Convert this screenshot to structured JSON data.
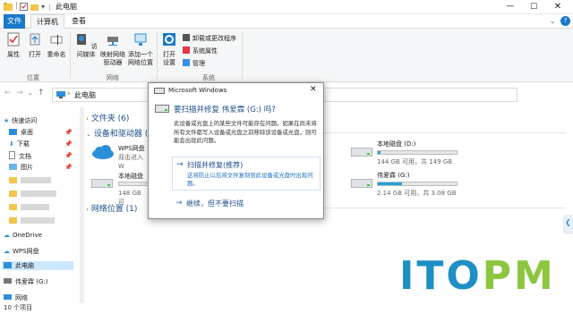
{
  "window": {
    "title": "此电脑"
  },
  "tabs": {
    "file": "文件",
    "computer": "计算机",
    "view": "查看"
  },
  "ribbon": {
    "properties": "属性",
    "open": "打开",
    "rename": "重命名",
    "group_location": "位置",
    "access_media": "访问媒体",
    "map_drive": "映射网络驱动器",
    "add_location": "添加一个网络位置",
    "group_network": "网络",
    "open_settings": "打开设置",
    "uninstall": "卸载或更改程序",
    "system_props": "系统属性",
    "manage": "管理",
    "group_system": "系统"
  },
  "address": {
    "path": "此电脑"
  },
  "nav": {
    "quick_access": "快速访问",
    "desktop": "桌面",
    "downloads": "下载",
    "documents": "文档",
    "pictures": "图片",
    "onedrive": "OneDrive",
    "wps": "WPS网盘",
    "this_pc": "此电脑",
    "usb": "伟爱霖 (G:)",
    "network": "网络"
  },
  "content": {
    "folders_header": "文件夹 (6)",
    "devices_header": "设备和驱动器 (6",
    "wps_name": "WPS网盘",
    "wps_sub": "双击进入W",
    "local_c_name": "本地磁盘",
    "local_c_size": "148 GB 可",
    "local_d_name": "本地磁盘 (D:)",
    "local_d_size": "144 GB 可用，共 149 GB",
    "local_d_usage": 0.03,
    "usb_name": "伟爱霖 (G:)",
    "usb_size": "2.14 GB 可用，共 3.08 GB",
    "usb_usage": 0.31,
    "network_header": "网络位置 (1)"
  },
  "dialog": {
    "title": "Microsoft Windows",
    "heading": "要扫描并修复 伟爱霖 (G:) 吗?",
    "body": "此设备或光盘上的某些文件可能存在问题。如果在尚未将所有文件都写入设备或光盘之前移除该设备或光盘，则可能会出现此问题。",
    "opt1_title": "扫描并修复(推荐)",
    "opt1_desc": "这将防止以后将文件复制到此设备或光盘时出现问题。",
    "opt2_title": "继续，但不要扫描",
    "close": "✕"
  },
  "status": {
    "count": "10 个项目"
  },
  "watermark": "ITOPM",
  "colors": {
    "accent": "#1979ca",
    "link": "#1e4e8c",
    "bar": "#26a0da"
  }
}
